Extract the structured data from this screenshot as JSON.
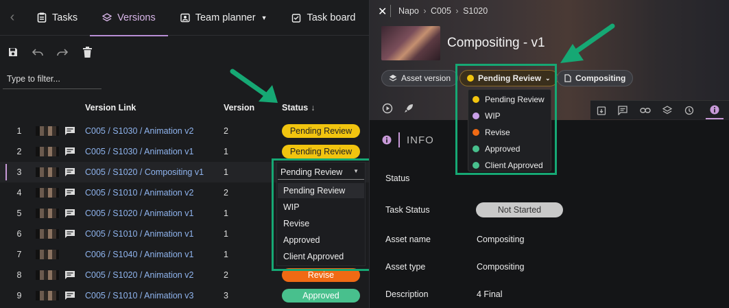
{
  "tabs": [
    {
      "label": "Tasks"
    },
    {
      "label": "Versions"
    },
    {
      "label": "Team planner"
    },
    {
      "label": "Task board"
    }
  ],
  "filter": {
    "placeholder": "Type to filter..."
  },
  "columns": {
    "link": "Version Link",
    "version": "Version",
    "status": "Status"
  },
  "rows": [
    {
      "n": "1",
      "link": "C005 / S1030 / Animation v2",
      "version": "2",
      "status": "Pending Review"
    },
    {
      "n": "2",
      "link": "C005 / S1030 / Animation v1",
      "version": "1",
      "status": "Pending Review"
    },
    {
      "n": "3",
      "link": "C005 / S1020 / Compositing v1",
      "version": "1",
      "status": "Pending Review"
    },
    {
      "n": "4",
      "link": "C005 / S1010 / Animation v2",
      "version": "2",
      "status": ""
    },
    {
      "n": "5",
      "link": "C005 / S1020 / Animation v1",
      "version": "1",
      "status": ""
    },
    {
      "n": "6",
      "link": "C005 / S1010 / Animation v1",
      "version": "1",
      "status": ""
    },
    {
      "n": "7",
      "link": "C006 / S1040 / Animation v1",
      "version": "1",
      "status": ""
    },
    {
      "n": "8",
      "link": "C005 / S1020 / Animation v2",
      "version": "2",
      "status": "Revise"
    },
    {
      "n": "9",
      "link": "C005 / S1010 / Animation v3",
      "version": "3",
      "status": "Approved"
    }
  ],
  "dropdown": {
    "selected": "Pending Review",
    "options": [
      "Pending Review",
      "WIP",
      "Revise",
      "Approved",
      "Client Approved"
    ]
  },
  "colors": {
    "pending": "#f1c40f",
    "wip": "#c9a0e8",
    "revise": "#f06a14",
    "approved": "#48c08d",
    "client_approved": "#48c08d",
    "highlight": "#16a874"
  },
  "panel": {
    "breadcrumb": [
      "Napo",
      "C005",
      "S1020"
    ],
    "title": "Compositing - v1",
    "chips": {
      "asset_version": "Asset version",
      "status": "Pending Review",
      "compositing": "Compositing"
    },
    "status_menu": [
      "Pending Review",
      "WIP",
      "Revise",
      "Approved",
      "Client Approved"
    ],
    "info_heading": "INFO",
    "fields": [
      {
        "label": "Status",
        "value": ""
      },
      {
        "label": "Task Status",
        "value": "Not Started"
      },
      {
        "label": "Asset name",
        "value": "Compositing"
      },
      {
        "label": "Asset type",
        "value": "Compositing"
      },
      {
        "label": "Description",
        "value": "4 Final"
      }
    ]
  }
}
